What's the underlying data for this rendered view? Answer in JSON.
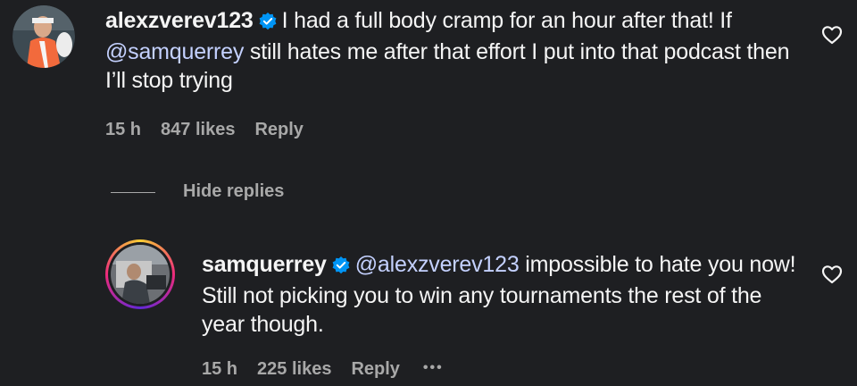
{
  "comments": [
    {
      "username": "alexzverev123",
      "text_before": "I had a full body cramp for an hour after that! If ",
      "mention": "@samquerrey",
      "text_after": " still hates me after that effort I put into that podcast then I’ll stop trying",
      "time": "15 h",
      "likes": "847 likes",
      "reply_label": "Reply"
    },
    {
      "username": "samquerrey",
      "mention": "@alexzverev123",
      "text_after": " impossible to hate you now! Still not picking you to win any tournaments the rest of the year though.",
      "time": "15 h",
      "likes": "225 likes",
      "reply_label": "Reply",
      "more_label": "•••"
    }
  ],
  "hide_replies_label": "Hide replies",
  "icons": {
    "verified": "verified-badge-icon",
    "like": "heart-icon",
    "more": "more-options-icon"
  },
  "colors": {
    "background": "#1e1f22",
    "mention": "#c4d1ff",
    "verified": "#0095f6",
    "secondary_text": "#a8a8a8"
  }
}
